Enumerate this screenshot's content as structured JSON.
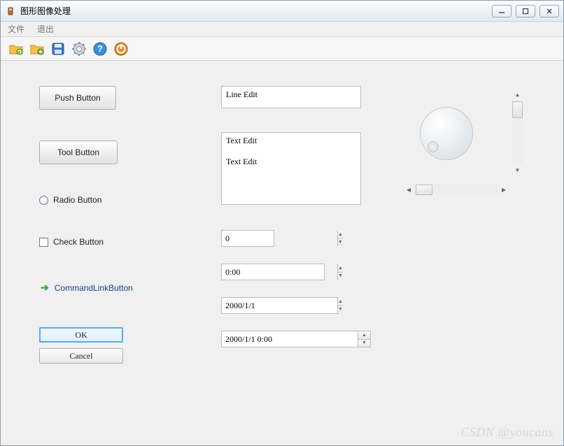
{
  "window": {
    "title": "图形图像处理"
  },
  "menubar": {
    "file": "文件",
    "exit": "退出"
  },
  "toolbar": {
    "icons": [
      "folder-refresh-icon",
      "folder-add-icon",
      "save-icon",
      "gear-icon",
      "help-icon",
      "power-icon"
    ]
  },
  "left": {
    "push_button": "Push Button",
    "tool_button": "Tool Button",
    "radio_label": "Radio Button",
    "check_label": "Check Button",
    "command_link": "CommandLinkButton",
    "ok": "OK",
    "cancel": "Cancel"
  },
  "mid": {
    "line_edit": "Line Edit",
    "text_edit": "Text Edit\n\nText Edit",
    "spin_value": "0",
    "time_value": "0:00",
    "date_value": "2000/1/1",
    "datetime_value": "2000/1/1 0:00"
  },
  "watermark_prefix": "CSDN ",
  "watermark_user": "@youcans"
}
